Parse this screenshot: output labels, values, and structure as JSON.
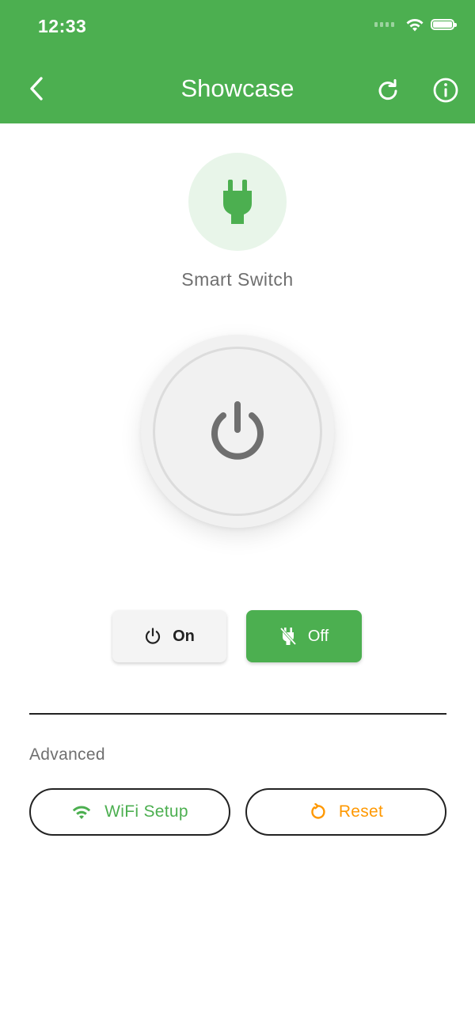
{
  "status_bar": {
    "time": "12:33"
  },
  "app_bar": {
    "title": "Showcase",
    "back_icon": "chevron-left-icon",
    "refresh_icon": "refresh-icon",
    "info_icon": "info-icon"
  },
  "device": {
    "icon": "plug-icon",
    "name": "Smart Switch"
  },
  "power_button": {
    "icon": "power-icon"
  },
  "controls": {
    "on_label": "On",
    "off_label": "Off",
    "selected": "Off"
  },
  "advanced": {
    "label": "Advanced",
    "wifi_label": "WiFi Setup",
    "reset_label": "Reset"
  },
  "colors": {
    "primary": "#4caf50",
    "light_primary": "#e8f5e9",
    "warning": "#ff9800",
    "text_secondary": "#6f6f6f"
  }
}
